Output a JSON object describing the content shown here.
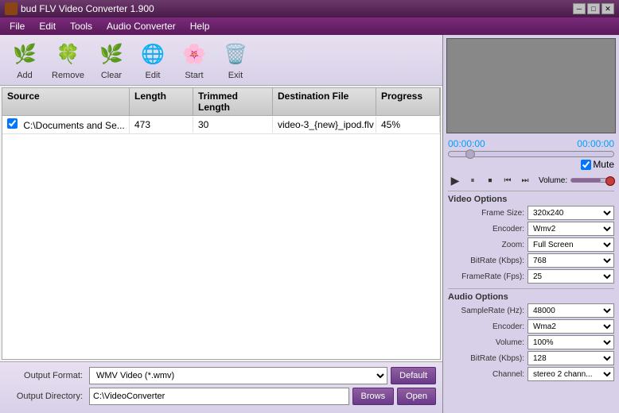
{
  "titleBar": {
    "title": "bud FLV Video Converter 1.900",
    "minimize": "─",
    "maximize": "□",
    "close": "✕"
  },
  "menuBar": {
    "items": [
      "File",
      "Edit",
      "Tools",
      "Audio Converter",
      "Help"
    ]
  },
  "toolbar": {
    "buttons": [
      {
        "id": "add",
        "label": "Add",
        "icon": "🌿"
      },
      {
        "id": "remove",
        "label": "Remove",
        "icon": "🍀"
      },
      {
        "id": "clear",
        "label": "Clear",
        "icon": "🌿"
      },
      {
        "id": "edit",
        "label": "Edit",
        "icon": "🌐"
      },
      {
        "id": "start",
        "label": "Start",
        "icon": "🌸"
      },
      {
        "id": "exit",
        "label": "Exit",
        "icon": "🗑️"
      }
    ]
  },
  "fileList": {
    "headers": [
      "Source",
      "Length",
      "Trimmed Length",
      "Destination File",
      "Progress"
    ],
    "rows": [
      {
        "checked": true,
        "source": "C:\\Documents and Se...",
        "length": "473",
        "trimmedLength": "30",
        "destFile": "video-3_{new}_ipod.flv",
        "progress": "45%"
      }
    ]
  },
  "bottomControls": {
    "outputFormatLabel": "Output Format:",
    "outputFormatValue": "WMV Video (*.wmv)",
    "defaultBtn": "Default",
    "outputDirLabel": "Output Directory:",
    "outputDirValue": "C:\\VideoConverter",
    "browseBtn": "Brows",
    "openBtn": "Open"
  },
  "rightPanel": {
    "timeStart": "00:00:00",
    "timeEnd": "00:00:00",
    "muteLabel": "Mute",
    "volumeLabel": "Volume:",
    "videoOptions": {
      "title": "Video Options",
      "fields": [
        {
          "label": "Frame Size:",
          "value": "320x240"
        },
        {
          "label": "Encoder:",
          "value": "Wmv2"
        },
        {
          "label": "Zoom:",
          "value": "Full Screen"
        },
        {
          "label": "BitRate (Kbps):",
          "value": "768"
        },
        {
          "label": "FrameRate (Fps):",
          "value": "25"
        }
      ]
    },
    "audioOptions": {
      "title": "Audio Options",
      "fields": [
        {
          "label": "SampleRate (Hz):",
          "value": "48000"
        },
        {
          "label": "Encoder:",
          "value": "Wma2"
        },
        {
          "label": "Volume:",
          "value": "100%"
        },
        {
          "label": "BitRate (Kbps):",
          "value": "128"
        },
        {
          "label": "Channel:",
          "value": "stereo 2 chann..."
        }
      ]
    }
  }
}
